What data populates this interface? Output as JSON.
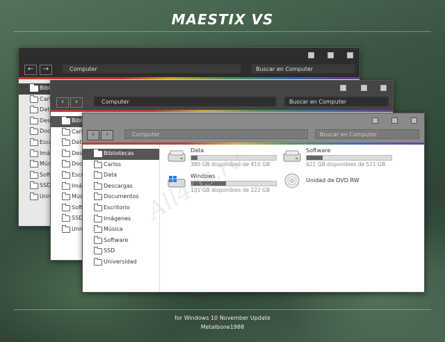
{
  "header": {
    "title": "MAESTIX VS"
  },
  "footer": {
    "line1": "for Windows 10 November Update",
    "line2": "Metalbone1988"
  },
  "watermark": "All4os.ru",
  "windows": {
    "back": {
      "address": "Computer",
      "search_placeholder": "Buscar en Computer",
      "nav": [
        "Bibli",
        "Carlo",
        "Data",
        "Desca",
        "Docu",
        "Escrit",
        "Imág",
        "Músi",
        "Softw",
        "SSD",
        "Univer"
      ]
    },
    "middle": {
      "address": "Computer",
      "search_placeholder": "Buscar en Computer",
      "nav": [
        "Biblio",
        "Carlo",
        "Data",
        "Desc",
        "Docu",
        "Escri",
        "Imág",
        "Músi",
        "Softw",
        "SSD",
        "Unive"
      ]
    },
    "front": {
      "address": "Computer",
      "search_placeholder": "Buscar en Computer",
      "nav": [
        "Bibliotecas",
        "Carlos",
        "Data",
        "Descargas",
        "Documentos",
        "Escritorio",
        "Imágenes",
        "Música",
        "Software",
        "SSD",
        "Universidad"
      ],
      "selected_nav": 0,
      "drives": [
        {
          "name": "Data",
          "free": "380 GB disponibles de 410 GB",
          "used_fraction": 0.07,
          "icon": "hard-drive-icon"
        },
        {
          "name": "Software",
          "free": "421 GB disponibles de 521 GB",
          "used_fraction": 0.19,
          "icon": "hard-drive-icon"
        },
        {
          "name": "Windows",
          "free": "131 GB disponibles de 222 GB",
          "used_fraction": 0.41,
          "icon": "windows-drive-icon"
        },
        {
          "name": "Unidad de DVD RW",
          "icon": "dvd-drive-icon"
        }
      ]
    }
  },
  "colors": {
    "accent_stripe": [
      "#c83a30",
      "#e0b030",
      "#50a050",
      "#3a70c0",
      "#7a3aa0"
    ],
    "selection": "#555555"
  }
}
